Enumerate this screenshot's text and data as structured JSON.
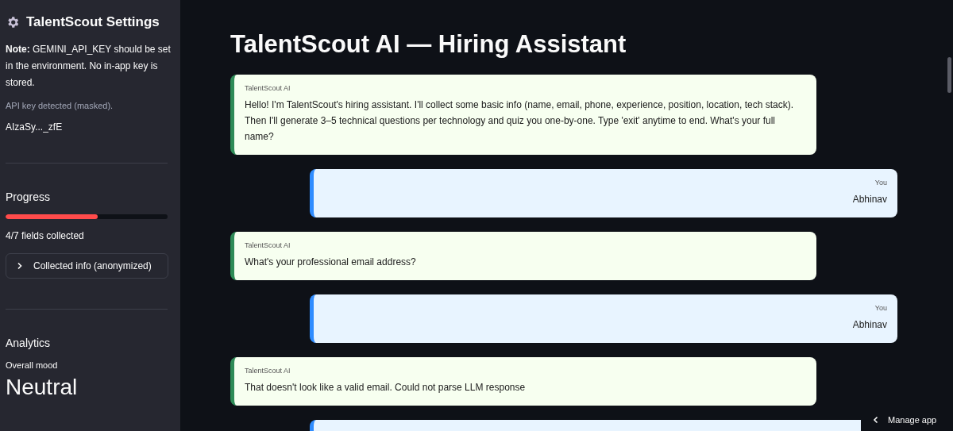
{
  "sidebar": {
    "title": "TalentScout Settings",
    "note": "**Note:** GEMINI_API_KEY should be set in the environment. No in-app key is stored.",
    "key_status": "API key detected (masked).",
    "key_value": "AIzaSy..._zfE",
    "progress": {
      "heading": "Progress",
      "level": 0.571,
      "caption": "4/7 fields collected"
    },
    "expander": {
      "label": "Collected info (anonymized)",
      "expanded": false
    },
    "analytics": {
      "heading": "Analytics",
      "metric_label": "Overall mood",
      "metric_value": "Neutral"
    }
  },
  "main": {
    "title": "TalentScout AI — Hiring Assistant",
    "messages": [
      {
        "kind": "bot",
        "sender": "TalentScout AI",
        "text": "Hello! I'm TalentScout's hiring assistant. I'll collect some basic info (name, email, phone, experience, position, location, tech stack). Then I'll generate 3–5 technical questions per technology and quiz you one-by-one. Type 'exit' anytime to end. What's your full name?"
      },
      {
        "kind": "user",
        "sender": "You",
        "text": "Abhinav"
      },
      {
        "kind": "bot",
        "sender": "TalentScout AI",
        "text": "What's your professional email address?"
      },
      {
        "kind": "user",
        "sender": "You",
        "text": "Abhinav"
      },
      {
        "kind": "bot",
        "sender": "TalentScout AI",
        "text": "That doesn't look like a valid email. Could not parse LLM response"
      },
      {
        "kind": "user"
      }
    ]
  },
  "manage_button": "Manage app"
}
